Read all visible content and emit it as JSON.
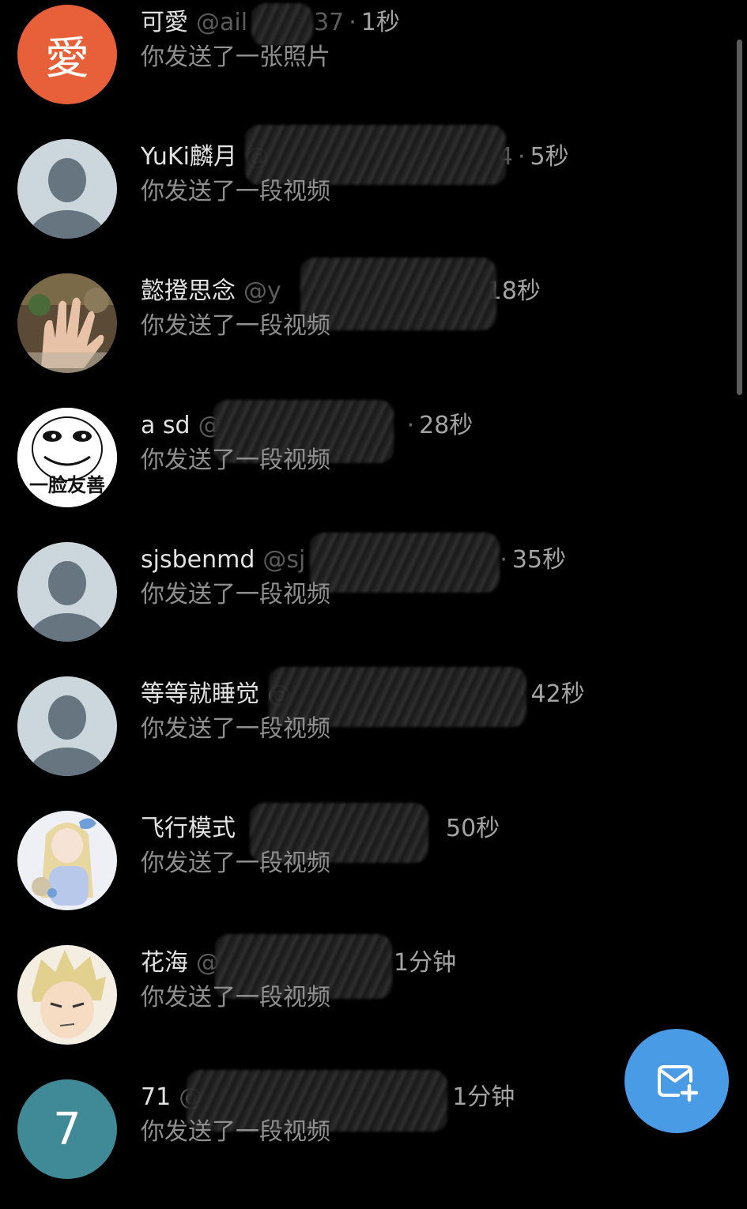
{
  "conversations": [
    {
      "name": "可愛",
      "handle": "@ail",
      "handle_tail": "37",
      "time": "1秒",
      "preview": "你发送了一张照片",
      "avatar_text": "愛",
      "avatar_color": "#e8603a"
    },
    {
      "name": "YuKi麟月",
      "handle": "@",
      "handle_tail": "4",
      "time": "5秒",
      "preview": "你发送了一段视频",
      "avatar_text": "",
      "avatar_color": "#ccd6dd"
    },
    {
      "name": "懿撜思念",
      "handle": "@y",
      "handle_tail": "",
      "time": "18秒",
      "preview": "你发送了一段视频",
      "avatar_text": "",
      "avatar_color": "#6b5a44"
    },
    {
      "name": "a sd",
      "handle": "@",
      "handle_tail": "",
      "time": "28秒",
      "preview": "你发送了一段视频",
      "avatar_text": "一脸友善",
      "avatar_color": "#ffffff"
    },
    {
      "name": "sjsbenmd",
      "handle": "@sj",
      "handle_tail": "",
      "time": "35秒",
      "preview": "你发送了一段视频",
      "avatar_text": "",
      "avatar_color": "#ccd6dd"
    },
    {
      "name": "等等就睡觉",
      "handle": "@",
      "handle_tail": "",
      "time": "42秒",
      "preview": "你发送了一段视频",
      "avatar_text": "",
      "avatar_color": "#ccd6dd"
    },
    {
      "name": "飞行模式",
      "handle": "",
      "handle_tail": "",
      "time": "50秒",
      "preview": "你发送了一段视频",
      "avatar_text": "",
      "avatar_color": "#e9edf3"
    },
    {
      "name": "花海",
      "handle": "@",
      "handle_tail": "",
      "time": "1分钟",
      "preview": "你发送了一段视频",
      "avatar_text": "",
      "avatar_color": "#d7c9a0"
    },
    {
      "name": "71",
      "handle": "@",
      "handle_tail": "",
      "time": "1分钟",
      "preview": "你发送了一段视频",
      "avatar_text": "7",
      "avatar_color": "#3f8a96"
    }
  ],
  "fab": {
    "icon": "new-message-icon"
  },
  "colors": {
    "background": "#000000",
    "fab": "#4a9be6",
    "name": "#e2e2e2",
    "handle": "#5b5b5b",
    "preview": "#8f8f8f"
  }
}
